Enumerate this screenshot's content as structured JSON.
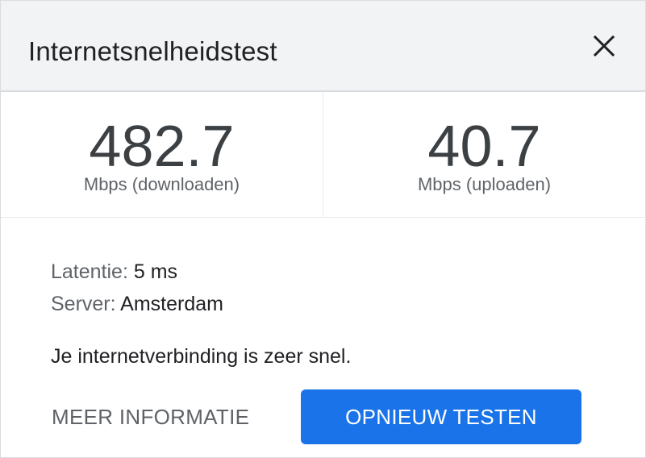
{
  "dialog": {
    "title": "Internetsnelheidstest",
    "close_icon": "close-icon"
  },
  "results": {
    "download": {
      "value": "482.7",
      "unit": "Mbps (downloaden)"
    },
    "upload": {
      "value": "40.7",
      "unit": "Mbps (uploaden)"
    }
  },
  "details": {
    "latency_label": "Latentie:",
    "latency_value": "5 ms",
    "server_label": "Server:",
    "server_value": "Amsterdam"
  },
  "message": "Je internetverbinding is zeer snel.",
  "actions": {
    "more_info": "MEER INFORMATIE",
    "retest": "OPNIEUW TESTEN"
  },
  "colors": {
    "header_bg": "#f1f3f4",
    "accent": "#1a73e8",
    "text_primary": "#202124",
    "text_secondary": "#5f6368"
  }
}
